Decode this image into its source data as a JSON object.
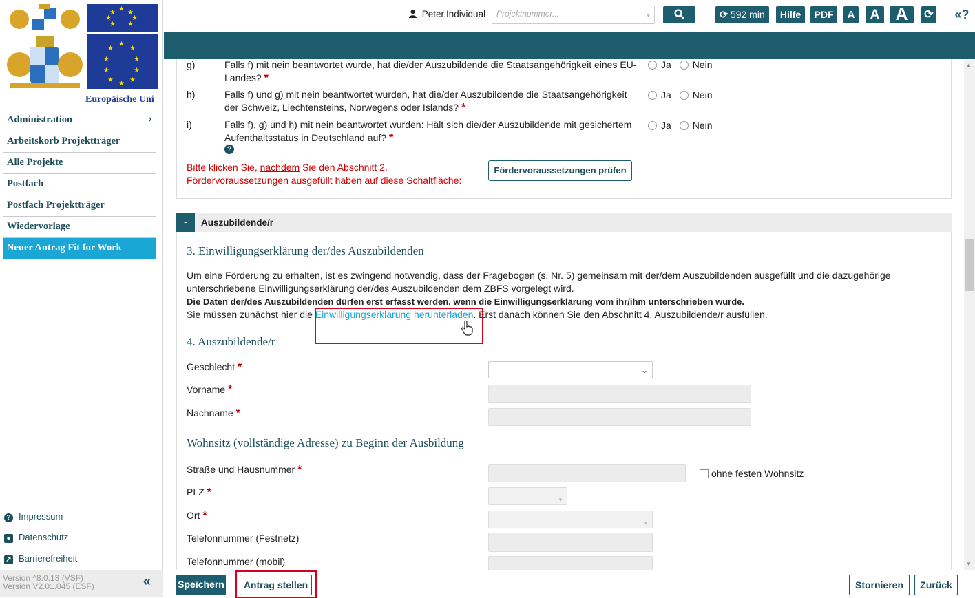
{
  "sidebar": {
    "eu_label": "Europäische Uni",
    "nav": [
      {
        "label": "Administration",
        "has_chevron": true
      },
      {
        "label": "Arbeitskorb Projektträger"
      },
      {
        "label": "Alle Projekte"
      },
      {
        "label": "Postfach"
      },
      {
        "label": "Postfach Projektträger"
      },
      {
        "label": "Wiedervorlage"
      },
      {
        "label": "Neuer Antrag Fit for Work",
        "active": true
      }
    ],
    "footer_links": [
      "Impressum",
      "Datenschutz",
      "Barrierefreiheit"
    ],
    "version_1": "Version ^8.0.13 (VSF)",
    "version_2": "Version V2.01.045 (ESF)"
  },
  "topbar": {
    "user": "Peter.Individual",
    "search_placeholder": "Projektnummer...",
    "timer": "592 min",
    "help": "Hilfe",
    "pdf": "PDF",
    "font_a": "A"
  },
  "questions": [
    {
      "letter": "g)",
      "text": "Falls f) mit nein beantwortet wurde, hat die/der Auszubildende die Staatsangehörigkeit eines EU-Landes?"
    },
    {
      "letter": "h)",
      "text": "Falls f) und g) mit nein beantwortet wurden, hat die/der Auszubildende die Staatsangehörigkeit der Schweiz, Liechtensteins, Norwegens oder Islands?"
    },
    {
      "letter": "i)",
      "text": "Falls f), g) und h) mit nein beantwortet wurden: Hält sich die/der Auszubildende mit gesichertem Aufenthaltsstatus in Deutschland auf?"
    }
  ],
  "radio": {
    "yes": "Ja",
    "no": "Nein"
  },
  "note": {
    "part1": "Bitte klicken Sie, ",
    "underlined": "nachdem",
    "part2": " Sie den Abschnitt 2.",
    "line2": "Fördervoraussetzungen ausgefüllt haben auf diese Schaltfläche:"
  },
  "check_button": "Fördervoraussetzungen prüfen",
  "section": {
    "toggle": "-",
    "title": "Auszubildende/r",
    "h3_consent": "3. Einwilligungserklärung der/des Auszubildenden",
    "para1": "Um eine Förderung zu erhalten, ist es zwingend notwendig, dass der Fragebogen (s. Nr. 5) gemeinsam mit der/dem Auszubildenden ausgefüllt und die dazugehörige unterschriebene Einwilligungserklärung der/des Auszubildenden dem ZBFS vorgelegt wird.",
    "para_bold": "Die Daten der/des Auszubildenden dürfen erst erfasst werden, wenn die Einwilligungserklärung vom ihr/ihm unterschrieben wurde.",
    "download_pre": "Sie müssen zunächst hier die ",
    "download_link": "Einwilligungserklärung herunterladen",
    "download_post": ". Erst danach können Sie den Abschnitt 4. Auszubildende/r ausfüllen.",
    "h3_trainee": "4. Auszubildende/r",
    "h3_address": "Wohnsitz (vollständige Adresse) zu Beginn der Ausbildung",
    "fields": {
      "gender": "Geschlecht",
      "firstname": "Vorname",
      "lastname": "Nachname",
      "street": "Straße und Hausnummer",
      "no_residence": "ohne festen Wohnsitz",
      "zip": "PLZ",
      "city": "Ort",
      "phone": "Telefonnummer (Festnetz)",
      "mobile": "Telefonnummer (mobil)"
    }
  },
  "bottombar": {
    "save": "Speichern",
    "submit": "Antrag stellen",
    "cancel": "Stornieren",
    "back": "Zurück"
  },
  "colors": {
    "teal": "#1d5d6e",
    "active": "#1aa7d6",
    "highlight": "#d9001b",
    "required": "#b00000"
  }
}
